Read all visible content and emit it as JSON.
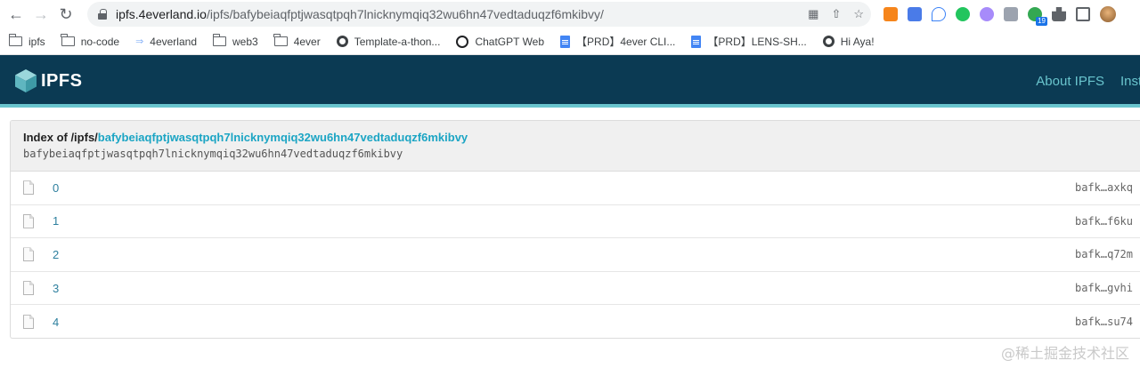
{
  "browser": {
    "url_host": "ipfs.4everland.io",
    "url_path": "/ipfs/bafybeiaqfptjwasqtpqh7lnicknymqiq32wu6hn47vedtaduqzf6mkibvy/",
    "extension_badge": "19"
  },
  "bookmarks": [
    {
      "label": "ipfs",
      "icon": "folder-icon"
    },
    {
      "label": "no-code",
      "icon": "folder-icon"
    },
    {
      "label": "4everland",
      "icon": "4everland-icon"
    },
    {
      "label": "web3",
      "icon": "folder-icon"
    },
    {
      "label": "4ever",
      "icon": "folder-icon"
    },
    {
      "label": "Template-a-thon...",
      "icon": "globe-icon"
    },
    {
      "label": "ChatGPT Web",
      "icon": "chatgpt-icon"
    },
    {
      "label": "【PRD】4ever CLI...",
      "icon": "google-doc-icon"
    },
    {
      "label": "【PRD】LENS-SH...",
      "icon": "google-doc-icon"
    },
    {
      "label": "Hi Aya!",
      "icon": "globe-icon"
    }
  ],
  "header": {
    "logo_text": "IPFS",
    "nav": [
      "About IPFS",
      "Install"
    ]
  },
  "listing": {
    "title_prefix": "Index of /ipfs/",
    "title_cid": "bafybeiaqfptjwasqtpqh7lnicknymqiq32wu6hn47vedtaduqzf6mkibvy",
    "cid": "bafybeiaqfptjwasqtpqh7lnicknymqiq32wu6hn47vedtaduqzf6mkibvy",
    "rows": [
      {
        "name": "0",
        "hash": "bafk…axkq"
      },
      {
        "name": "1",
        "hash": "bafk…f6ku"
      },
      {
        "name": "2",
        "hash": "bafk…q72m"
      },
      {
        "name": "3",
        "hash": "bafk…gvhi"
      },
      {
        "name": "4",
        "hash": "bafk…su74"
      }
    ]
  },
  "watermark": "@稀土掘金技术社区",
  "colors": {
    "header_bg": "#0b3a53",
    "accent": "#69c4cd",
    "link": "#1ca5c4"
  }
}
